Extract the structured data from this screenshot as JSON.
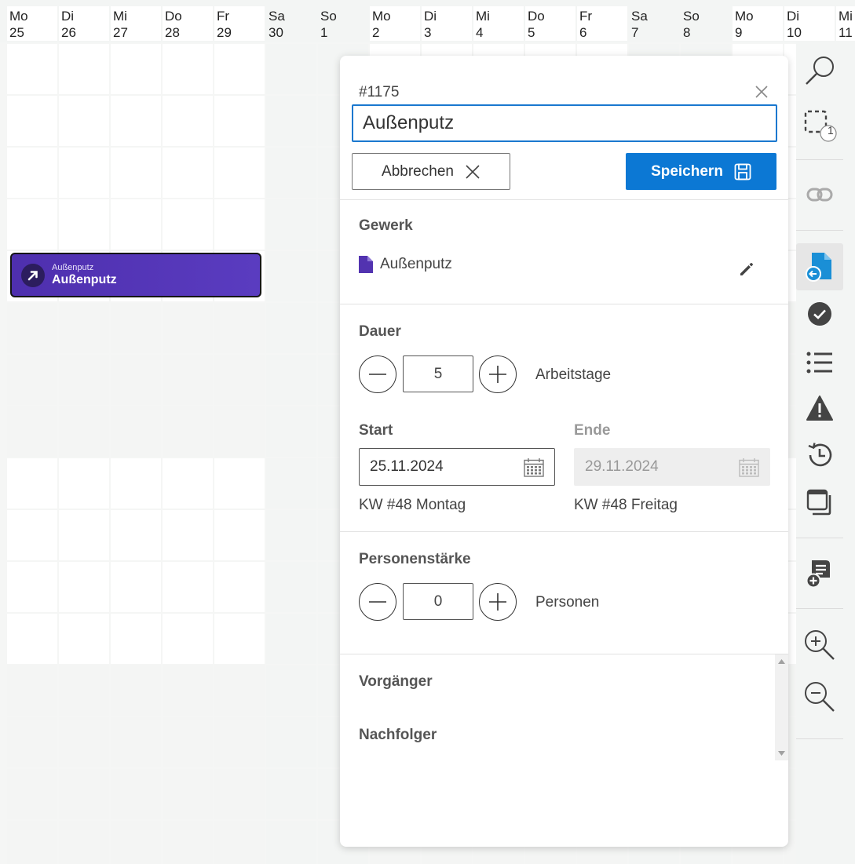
{
  "header": {
    "days": [
      {
        "wd": "Mo",
        "d": "25",
        "we": false
      },
      {
        "wd": "Di",
        "d": "26",
        "we": false
      },
      {
        "wd": "Mi",
        "d": "27",
        "we": false
      },
      {
        "wd": "Do",
        "d": "28",
        "we": false
      },
      {
        "wd": "Fr",
        "d": "29",
        "we": false
      },
      {
        "wd": "Sa",
        "d": "30",
        "we": true
      },
      {
        "wd": "So",
        "d": "1",
        "we": true
      },
      {
        "wd": "Mo",
        "d": "2",
        "we": false
      },
      {
        "wd": "Di",
        "d": "3",
        "we": false
      },
      {
        "wd": "Mi",
        "d": "4",
        "we": false
      },
      {
        "wd": "Do",
        "d": "5",
        "we": false
      },
      {
        "wd": "Fr",
        "d": "6",
        "we": false
      },
      {
        "wd": "Sa",
        "d": "7",
        "we": true
      },
      {
        "wd": "So",
        "d": "8",
        "we": true
      },
      {
        "wd": "Mo",
        "d": "9",
        "we": false
      },
      {
        "wd": "Di",
        "d": "10",
        "we": false
      },
      {
        "wd": "Mi",
        "d": "11",
        "we": false
      }
    ]
  },
  "task_bar": {
    "small_label": "Außenputz",
    "label": "Außenputz"
  },
  "dialog": {
    "task_id": "#1175",
    "title_value": "Außenputz",
    "cancel_label": "Abbrechen",
    "save_label": "Speichern",
    "gewerk": {
      "title": "Gewerk",
      "value": "Außenputz"
    },
    "dauer": {
      "title": "Dauer",
      "value": "5",
      "unit": "Arbeitstage"
    },
    "start": {
      "title": "Start",
      "value": "25.11.2024",
      "kw": "KW #48 Montag"
    },
    "ende": {
      "title": "Ende",
      "value": "29.11.2024",
      "kw": "KW #48 Freitag"
    },
    "personen": {
      "title": "Personenstärke",
      "value": "0",
      "unit": "Personen"
    },
    "vorgaenger_title": "Vorgänger",
    "nachfolger_title": "Nachfolger"
  },
  "toolbar": {
    "selection_count": "1",
    "icons": [
      "search-icon",
      "selection-icon",
      "link-icon",
      "file-import-icon",
      "check-circle-icon",
      "list-icon",
      "warning-icon",
      "history-icon",
      "window-stack-icon",
      "add-document-icon",
      "zoom-in-icon",
      "zoom-out-icon"
    ]
  },
  "colors": {
    "accent": "#0c78d4",
    "task_bar": "#5b35b5",
    "active_tool": "#1a8fd6"
  }
}
